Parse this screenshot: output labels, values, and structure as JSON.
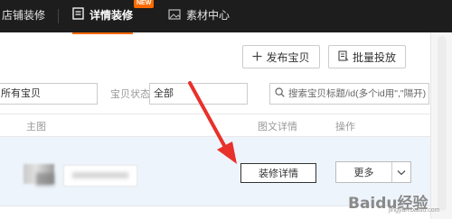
{
  "topnav": {
    "tabs": [
      {
        "label": "店铺装修",
        "icon": "shop-icon"
      },
      {
        "label": "详情装修",
        "icon": "document-icon",
        "badge": "NEW",
        "active": true
      },
      {
        "label": "素材中心",
        "icon": "image-folder-icon"
      }
    ]
  },
  "toolbar": {
    "publish_label": "发布宝贝",
    "batch_label": "批量投放"
  },
  "filters": {
    "category_value": "所有宝贝",
    "status_label": "宝贝状态",
    "status_value": "全部",
    "search_placeholder": "搜索宝贝标题/id(多个id用\",\"隔开)"
  },
  "table": {
    "columns": [
      "主图",
      "图文详情",
      "操作"
    ],
    "rows": [
      {
        "decorate_label": "装修详情",
        "more_label": "更多"
      }
    ]
  },
  "watermark": {
    "text": "Baidu经验",
    "sub": "jingyan.baidu.com"
  },
  "colors": {
    "nav_bg": "#1d1d1d",
    "accent": "#ff6a00",
    "row_bg": "#eef4fb",
    "arrow": "#e8312a"
  }
}
